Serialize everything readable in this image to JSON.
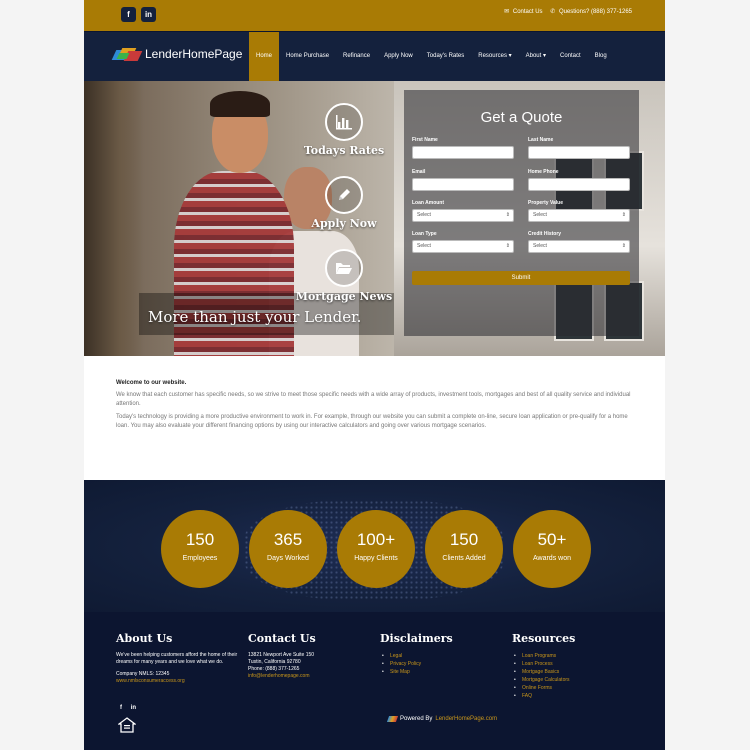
{
  "topbar": {
    "social": [
      "f",
      "in"
    ],
    "contact_label": "Contact Us",
    "questions_label": "Questions? (888) 377-1265"
  },
  "brand": {
    "name": "LenderHomePage"
  },
  "nav": {
    "items": [
      "Home",
      "Home Purchase",
      "Refinance",
      "Apply Now",
      "Today's Rates",
      "Resources ▾",
      "About ▾",
      "Contact",
      "Blog"
    ],
    "active": "Home"
  },
  "hero": {
    "actions": [
      "Todays Rates",
      "Apply Now",
      "Mortgage News"
    ],
    "tagline": "More than just your Lender."
  },
  "quote_form": {
    "title": "Get a Quote",
    "first_name_label": "First Name",
    "last_name_label": "Last Name",
    "email_label": "Email",
    "home_phone_label": "Home Phone",
    "loan_amount_label": "Loan Amount",
    "property_value_label": "Property Value",
    "loan_type_label": "Loan Type",
    "credit_history_label": "Credit History",
    "select_value": "Select",
    "submit_label": "Submit"
  },
  "welcome": {
    "heading": "Welcome to our website.",
    "p1": "We know that each customer has specific needs, so we strive to meet those specific needs with a wide array of products, investment tools, mortgages and best of all quality service and individual attention.",
    "p2": "Today's technology is providing a more productive environment to work in. For example, through our website you can submit a complete on-line, secure loan application or pre-qualify for a home loan. You may also evaluate your different financing options by using our interactive calculators and going over various mortgage scenarios."
  },
  "stats": [
    {
      "num": "150",
      "cap": "Employees"
    },
    {
      "num": "365",
      "cap": "Days Worked"
    },
    {
      "num": "100+",
      "cap": "Happy Clients"
    },
    {
      "num": "150",
      "cap": "Clients Added"
    },
    {
      "num": "50+",
      "cap": "Awards won"
    }
  ],
  "footer": {
    "about": {
      "title": "About Us",
      "text": "We've been helping customers afford the home of their dreams for many years and we love what we do.",
      "nmls": "Company NMLS: 12345",
      "nmls_link": "www.nmlsconsumeraccess.org"
    },
    "contact": {
      "title": "Contact Us",
      "address1": "13821 Newport Ave Suite 150",
      "address2": "Tustin, California 92780",
      "phone": "Phone: (888) 377-1265",
      "email": "info@lenderhomepage.com"
    },
    "disclaimers": {
      "title": "Disclaimers",
      "links": [
        "Legal",
        "Privacy Policy",
        "Site Map"
      ]
    },
    "resources": {
      "title": "Resources",
      "links": [
        "Loan Programs",
        "Loan Process",
        "Mortgage Basics",
        "Mortgage Calculators",
        "Online Forms",
        "FAQ"
      ]
    },
    "social": [
      "f",
      "in"
    ],
    "powered_prefix": "Powered By",
    "powered_link": "LenderHomePage.com"
  },
  "colors": {
    "gold": "#a97b05",
    "navy": "#14213d",
    "footer": "#0c1530"
  }
}
